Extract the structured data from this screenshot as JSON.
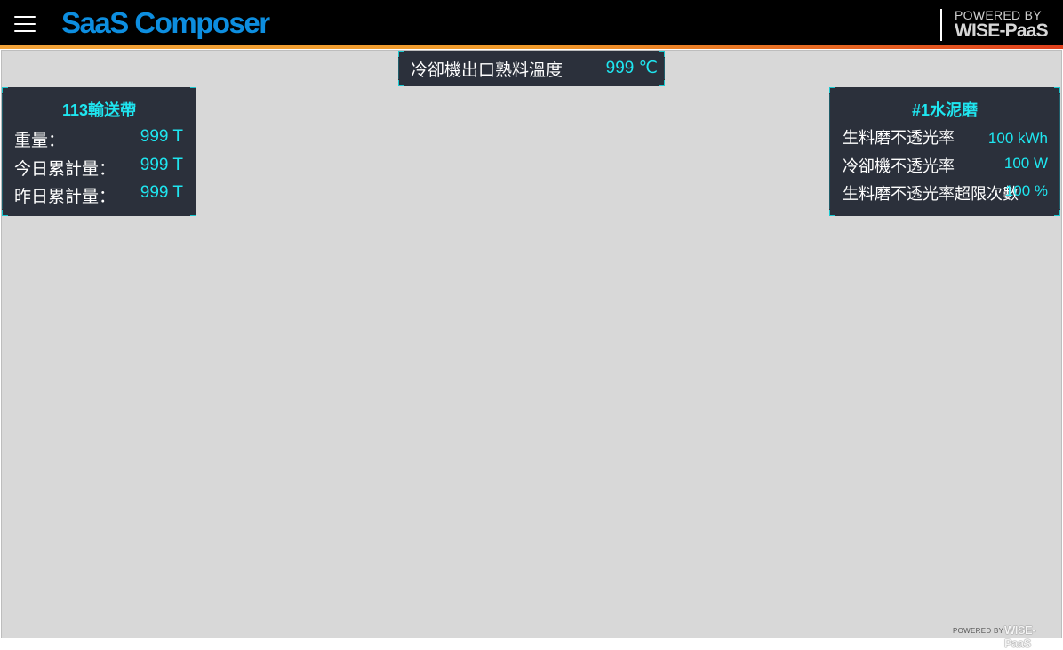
{
  "header": {
    "menu_icon": "hamburger-menu-icon",
    "app_title": "SaaS Composer",
    "powered_by_label": "POWERED BY",
    "powered_by_brand": "WISE-PaaS",
    "accent_colors": [
      "#f2a33a",
      "#e0401d"
    ],
    "title_color": "#0d8ee0"
  },
  "top_panel": {
    "label": "冷卻機出口熟料溫度",
    "value": "999 ℃"
  },
  "left_panel": {
    "title": "113輸送帶",
    "rows": [
      {
        "label": "重量：",
        "value": "999 T"
      },
      {
        "label": "今日累計量：",
        "value": "999 T"
      },
      {
        "label": "昨日累計量：",
        "value": "999 T"
      }
    ]
  },
  "right_panel": {
    "title": "#1水泥磨",
    "rows": [
      {
        "label": "生料磨不透光率",
        "value": "100 kWh"
      },
      {
        "label": "冷卻機不透光率",
        "value": "100 W"
      },
      {
        "label": "生料磨不透光率超限次數",
        "value": "100 %"
      }
    ]
  },
  "footer": {
    "powered_by_label": "POWERED BY",
    "powered_by_brand": "WISE-PaaS"
  },
  "theme": {
    "panel_bg": "#2b303b",
    "value_color": "#1fe6f0",
    "canvas_bg": "#d8d8d8"
  }
}
